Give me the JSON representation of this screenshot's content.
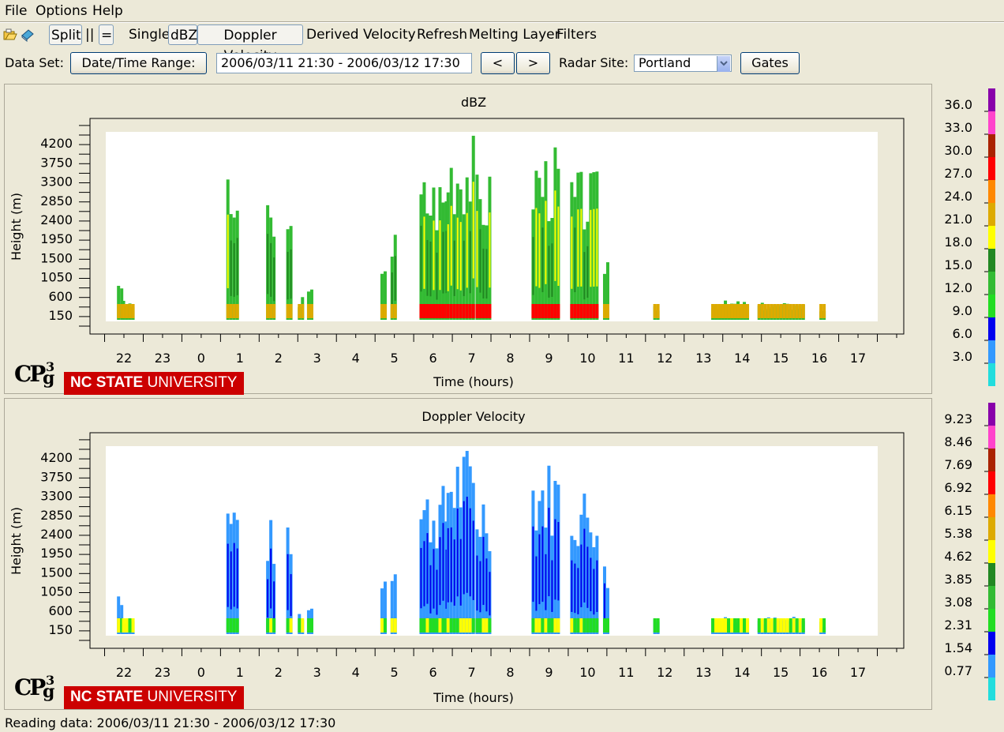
{
  "menu": {
    "file": "File",
    "options": "Options",
    "help": "Help"
  },
  "toolbar": {
    "split": "Split",
    "bars": "||",
    "equals": "=",
    "single": "Single",
    "dbz": "dBZ",
    "doppler": "Doppler Velocity",
    "derived": "Derived Velocity",
    "refresh": "Refresh",
    "melting": "Melting Layer",
    "filters": "Filters",
    "open_icon": "folder-open-icon",
    "book_icon": "book-icon"
  },
  "dataset": {
    "label": "Data Set:",
    "range_button": "Date/Time Range:",
    "range_value": "2006/03/11 21:30 - 2006/03/12 17:30",
    "prev": "<",
    "next": ">",
    "site_label": "Radar Site:",
    "site_value": "Portland",
    "gates": "Gates"
  },
  "charts": [
    {
      "title": "dBZ",
      "ylabel": "Height (m)",
      "xlabel": "Time (hours)",
      "yticks": [
        "4200",
        "3750",
        "3300",
        "2850",
        "2400",
        "1950",
        "1500",
        "1050",
        "600",
        "150"
      ],
      "xticks": [
        "22",
        "23",
        "0",
        "1",
        "2",
        "3",
        "4",
        "5",
        "6",
        "7",
        "8",
        "9",
        "10",
        "11",
        "12",
        "13",
        "14",
        "15",
        "16",
        "17"
      ],
      "legend_values": [
        "36.0",
        "33.0",
        "30.0",
        "27.0",
        "24.0",
        "21.0",
        "18.0",
        "15.0",
        "12.0",
        "9.0",
        "6.0",
        "3.0"
      ],
      "legend_colors": [
        "#8800aa",
        "#ff44cc",
        "#aa2200",
        "#ff0000",
        "#ff8800",
        "#ddaa00",
        "#ffff00",
        "#228822",
        "#33bb33",
        "#22dd22",
        "#0000ee",
        "#3399ff",
        "#22dddd"
      ]
    },
    {
      "title": "Doppler Velocity",
      "ylabel": "Height (m)",
      "xlabel": "Time (hours)",
      "yticks": [
        "4200",
        "3750",
        "3300",
        "2850",
        "2400",
        "1950",
        "1500",
        "1050",
        "600",
        "150"
      ],
      "xticks": [
        "22",
        "23",
        "0",
        "1",
        "2",
        "3",
        "4",
        "5",
        "6",
        "7",
        "8",
        "9",
        "10",
        "11",
        "12",
        "13",
        "14",
        "15",
        "16",
        "17"
      ],
      "legend_values": [
        "9.23",
        "8.46",
        "7.69",
        "6.92",
        "6.15",
        "5.38",
        "4.62",
        "3.85",
        "3.08",
        "2.31",
        "1.54",
        "0.77"
      ],
      "legend_colors": [
        "#8800aa",
        "#ff44cc",
        "#aa2200",
        "#ff0000",
        "#ff8800",
        "#ddaa00",
        "#ffff00",
        "#228822",
        "#33bb33",
        "#22dd22",
        "#0000ee",
        "#3399ff",
        "#22dddd"
      ]
    }
  ],
  "logo": {
    "cp": "CP",
    "g": "g",
    "sup": "3",
    "ncsu_bold": "NC STATE",
    "ncsu_rest": " UNIVERSITY"
  },
  "status": "Reading data: 2006/03/11 21:30 - 2006/03/12 17:30"
}
